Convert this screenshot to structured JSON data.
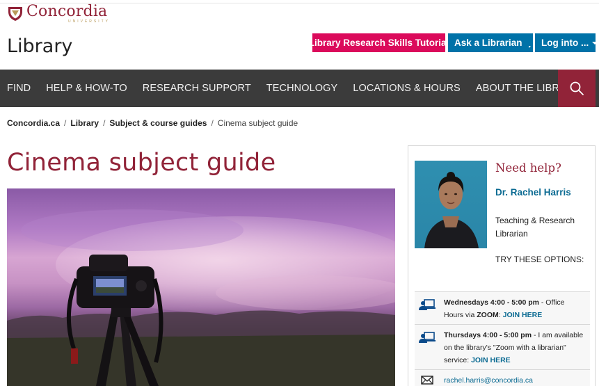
{
  "brand": {
    "logo_text": "Concordia",
    "logo_subtext": "UNIVERSITY",
    "site_title": "Library"
  },
  "header_buttons": {
    "tutorial": "Library Research Skills Tutorial",
    "ask": "Ask a Librarian",
    "login": "Log into ..."
  },
  "nav": {
    "items": [
      "FIND",
      "HELP & HOW-TO",
      "RESEARCH SUPPORT",
      "TECHNOLOGY",
      "LOCATIONS & HOURS",
      "ABOUT THE LIBRARY"
    ]
  },
  "breadcrumb": {
    "items": [
      "Concordia.ca",
      "Library",
      "Subject & course guides"
    ],
    "current": "Cinema subject guide",
    "separator": "/"
  },
  "page": {
    "title": "Cinema subject guide"
  },
  "sidebar": {
    "heading": "Need help?",
    "name": "Dr. Rachel Harris",
    "role": "Teaching & Research Librarian",
    "try_label": "TRY THESE OPTIONS:",
    "contacts": [
      {
        "icon": "video-call-icon",
        "bold": "Wednesdays 4:00 - 5:00 pm",
        "text_before": " - Office Hours via ",
        "bold2": "ZOOM",
        "text_after": ": ",
        "link": "JOIN HERE"
      },
      {
        "icon": "video-call-icon",
        "bold": "Thursdays 4:00 - 5:00 pm",
        "text_before": " - I am available on the library's \"Zoom with a librarian\" service: ",
        "link": "JOIN HERE"
      },
      {
        "icon": "envelope-icon",
        "email": "rachel.harris@concordia.ca"
      }
    ]
  },
  "colors": {
    "brand_maroon": "#912338",
    "tutorial_pink": "#db0a5b",
    "button_blue": "#0072a8",
    "nav_dark": "#3b3b3b",
    "link_blue": "#0a6a92"
  }
}
